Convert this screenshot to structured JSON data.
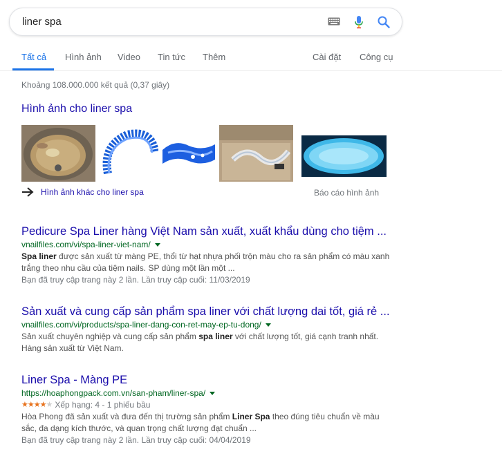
{
  "search": {
    "query": "liner spa"
  },
  "tabs": {
    "all": "Tất cả",
    "images": "Hình ảnh",
    "video": "Video",
    "news": "Tin tức",
    "more": "Thêm",
    "settings": "Cài đặt",
    "tools": "Công cụ"
  },
  "stats": "Khoảng 108.000.000 kết quả (0,37 giây)",
  "images_block": {
    "heading": "Hình ảnh cho liner spa",
    "more_link": "Hình ảnh khác cho liner spa",
    "report": "Báo cáo hình ảnh"
  },
  "results": [
    {
      "title": "Pedicure Spa Liner hàng Việt Nam sản xuất, xuất khẩu dùng cho tiệm ...",
      "url": "vnailfiles.com/vi/spa-liner-viet-nam/",
      "snippet_bold": "Spa liner",
      "snippet_rest": " được sản xuất từ màng PE, thổi từ hạt nhựa phối trộn màu cho ra sản phẩm có màu xanh trắng theo nhu cầu của tiệm nails. SP dùng một lần một ...",
      "visited": "Bạn đã truy cập trang này 2 lần. Lần truy cập cuối: 11/03/2019"
    },
    {
      "title": "Sản xuất và cung cấp sản phẩm spa liner với chất lượng dai tốt, giá rẻ ...",
      "url": "vnailfiles.com/vi/products/spa-liner-dang-con-ret-may-ep-tu-dong/",
      "snippet_pre": "Sản xuất chuyên nghiệp và cung cấp sản phẩm ",
      "snippet_bold": "spa liner",
      "snippet_post": " với chất lượng tốt, giá cạnh tranh nhất. Hàng sản xuất từ Việt Nam."
    },
    {
      "title": "Liner Spa - Màng PE",
      "url": "https://hoaphongpack.com.vn/san-pham/liner-spa/",
      "rating_value": 4,
      "stars": "★★★★★",
      "rating_text": "Xếp hạng: 4 - 1 phiếu bầu",
      "snippet_pre": "Hòa Phong đã sản xuất và đưa đến thị trường sản phẩm ",
      "snippet_bold": "Liner Spa",
      "snippet_post": " theo đúng tiêu chuẩn về màu sắc, đa dạng kích thước, và quan trọng chất lượng đạt chuẩn ...",
      "visited": "Bạn đã truy cập trang này 2 lần. Lần truy cập cuối: 04/04/2019"
    }
  ],
  "colors": {
    "link": "#1a0dab",
    "url": "#006621",
    "accent": "#1a73e8",
    "star": "#e7711b"
  }
}
